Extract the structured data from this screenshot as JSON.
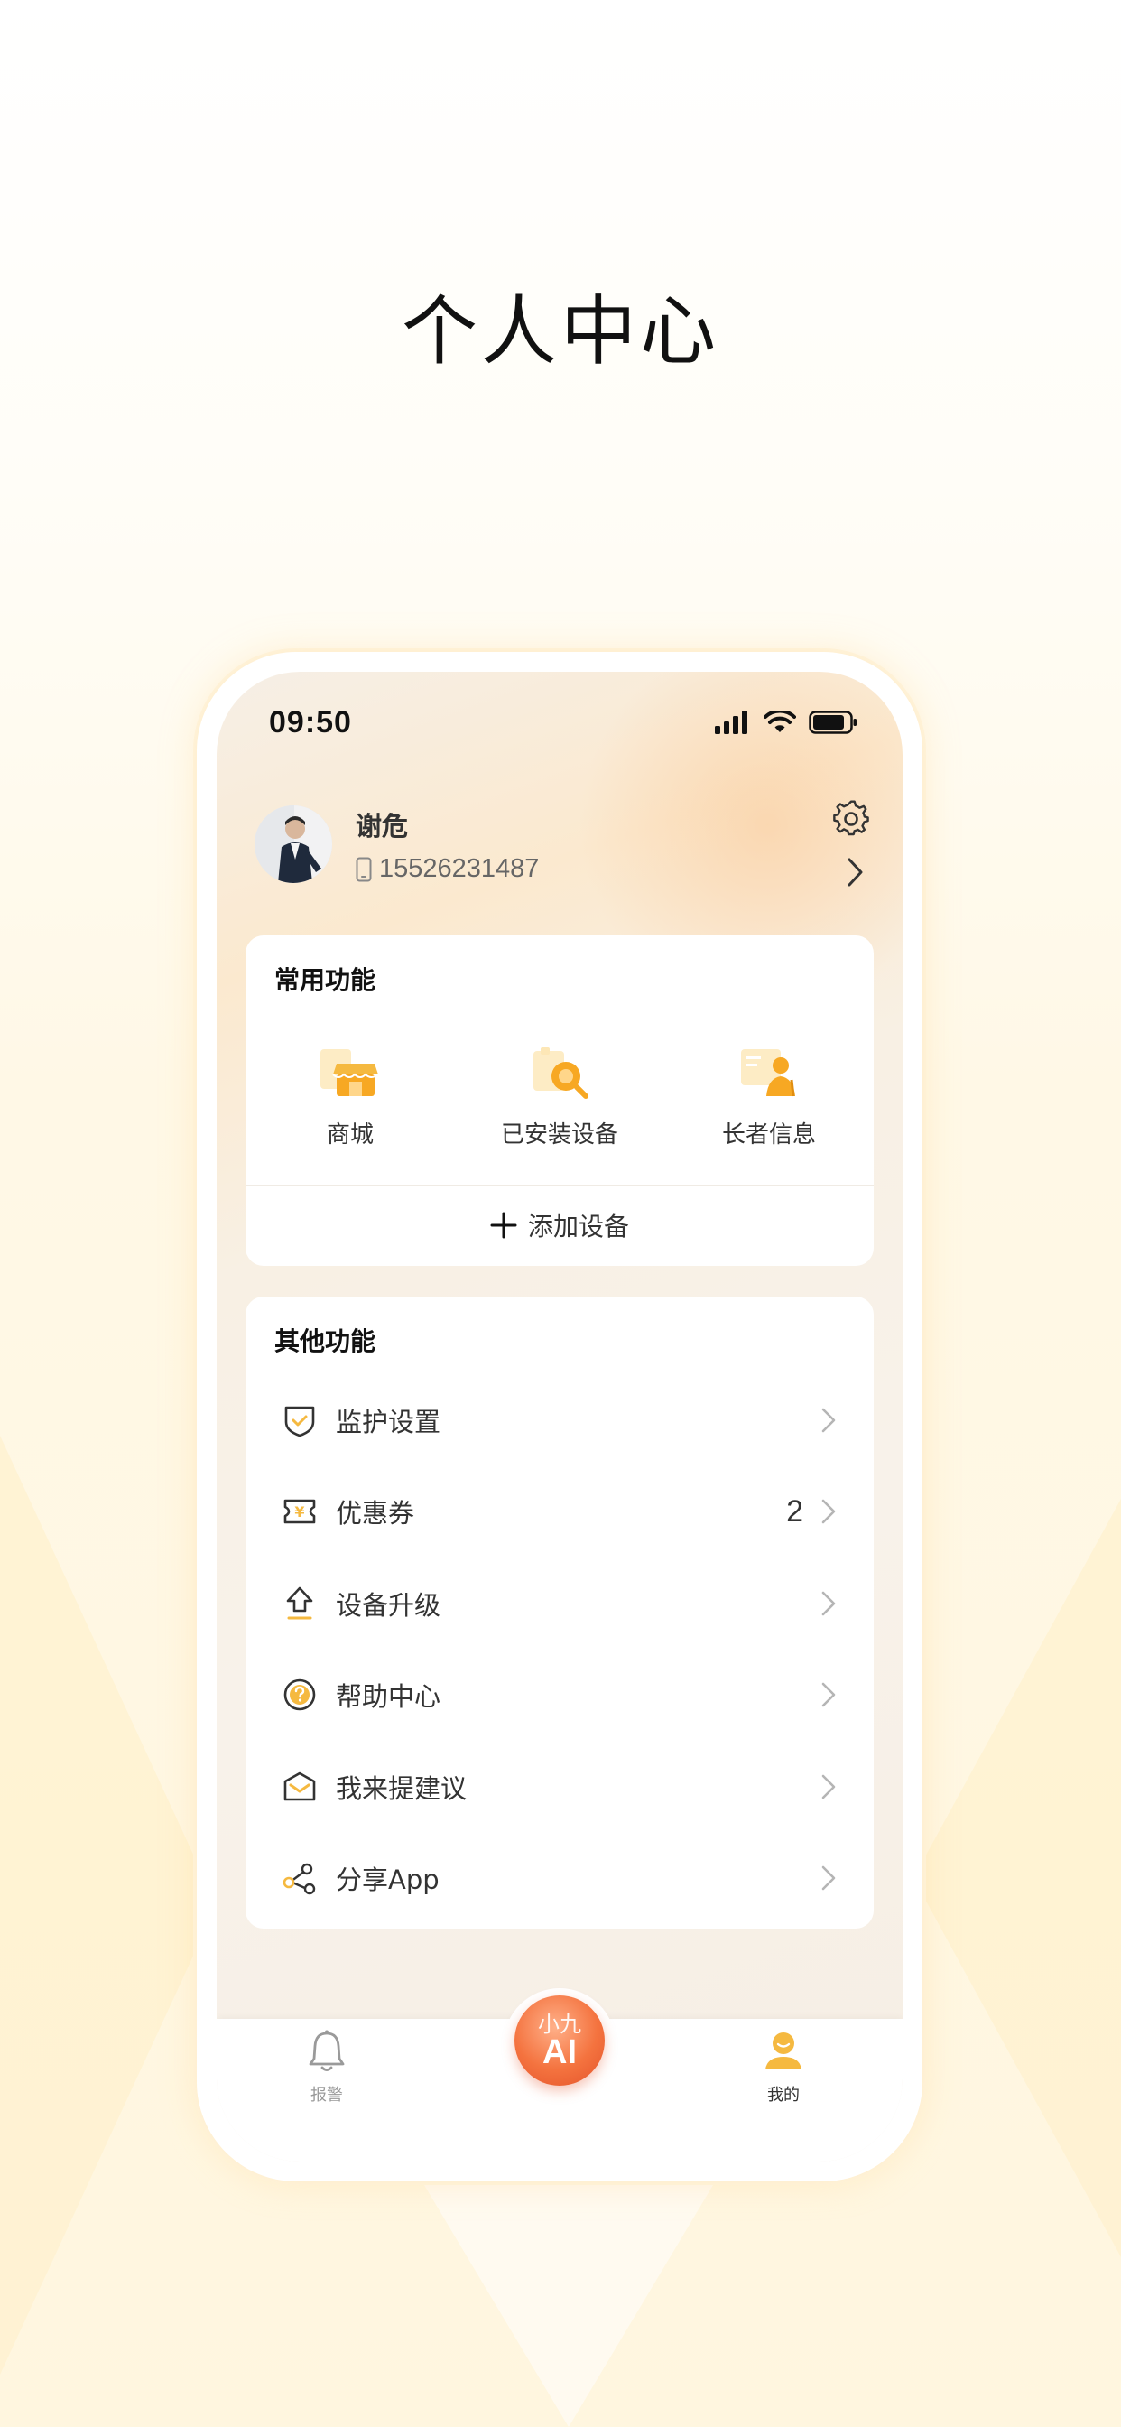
{
  "poster": {
    "title": "个人中心"
  },
  "status_bar": {
    "time": "09:50"
  },
  "profile": {
    "name": "谢危",
    "phone": "15526231487"
  },
  "common_functions": {
    "title": "常用功能",
    "items": [
      {
        "label": "商城",
        "icon": "shop-icon"
      },
      {
        "label": "已安装设备",
        "icon": "installed-device-icon"
      },
      {
        "label": "长者信息",
        "icon": "elder-info-icon"
      }
    ],
    "add_device_label": "添加设备"
  },
  "other_functions": {
    "title": "其他功能",
    "items": [
      {
        "label": "监护设置",
        "icon": "shield-check-icon",
        "badge": ""
      },
      {
        "label": "优惠券",
        "icon": "coupon-icon",
        "badge": "2"
      },
      {
        "label": "设备升级",
        "icon": "upgrade-icon",
        "badge": ""
      },
      {
        "label": "帮助中心",
        "icon": "help-icon",
        "badge": ""
      },
      {
        "label": "我来提建议",
        "icon": "feedback-mail-icon",
        "badge": ""
      },
      {
        "label": "分享App",
        "icon": "share-icon",
        "badge": ""
      }
    ]
  },
  "tab_bar": {
    "alarm_label": "报警",
    "ai_small": "小九",
    "ai_big": "AI",
    "mine_label": "我的"
  },
  "colors": {
    "accent": "#F5B940",
    "ai_orange": "#F4733F",
    "text": "#333333"
  }
}
